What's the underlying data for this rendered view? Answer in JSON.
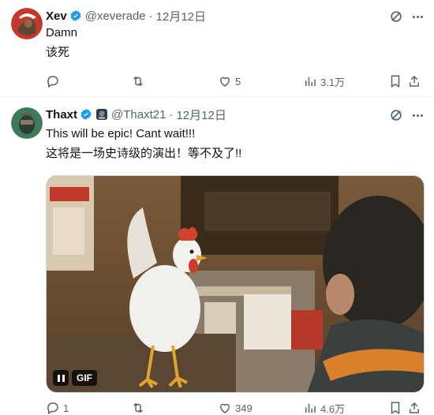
{
  "tweets": [
    {
      "name": "Xev",
      "handle": "@xeverade",
      "dot": "·",
      "date": "12月12日",
      "lines": [
        "Damn",
        "该死"
      ],
      "actions": {
        "replies": "",
        "retweets": "",
        "likes": "5",
        "views": "3.1万"
      }
    },
    {
      "name": "Thaxt",
      "handle": "@Thaxt21",
      "dot": "·",
      "date": "12月12日",
      "lines": [
        "This will be epic! Cant wait!!!",
        "这将是一场史诗级的演出！等不及了!!"
      ],
      "media": {
        "type": "GIF",
        "badge": "GIF"
      },
      "actions": {
        "replies": "1",
        "retweets": "",
        "likes": "349",
        "views": "4.6万"
      }
    }
  ],
  "icons": {
    "verified": "verified-badge-icon",
    "grok": "grok-icon",
    "more": "more-dots-icon",
    "reply": "reply-icon",
    "retweet": "retweet-icon",
    "like": "heart-icon",
    "views": "views-icon",
    "bookmark": "bookmark-icon",
    "share": "share-icon"
  },
  "colors": {
    "verified": "#1d9bf0",
    "muted": "#536471",
    "text": "#0f1419"
  }
}
